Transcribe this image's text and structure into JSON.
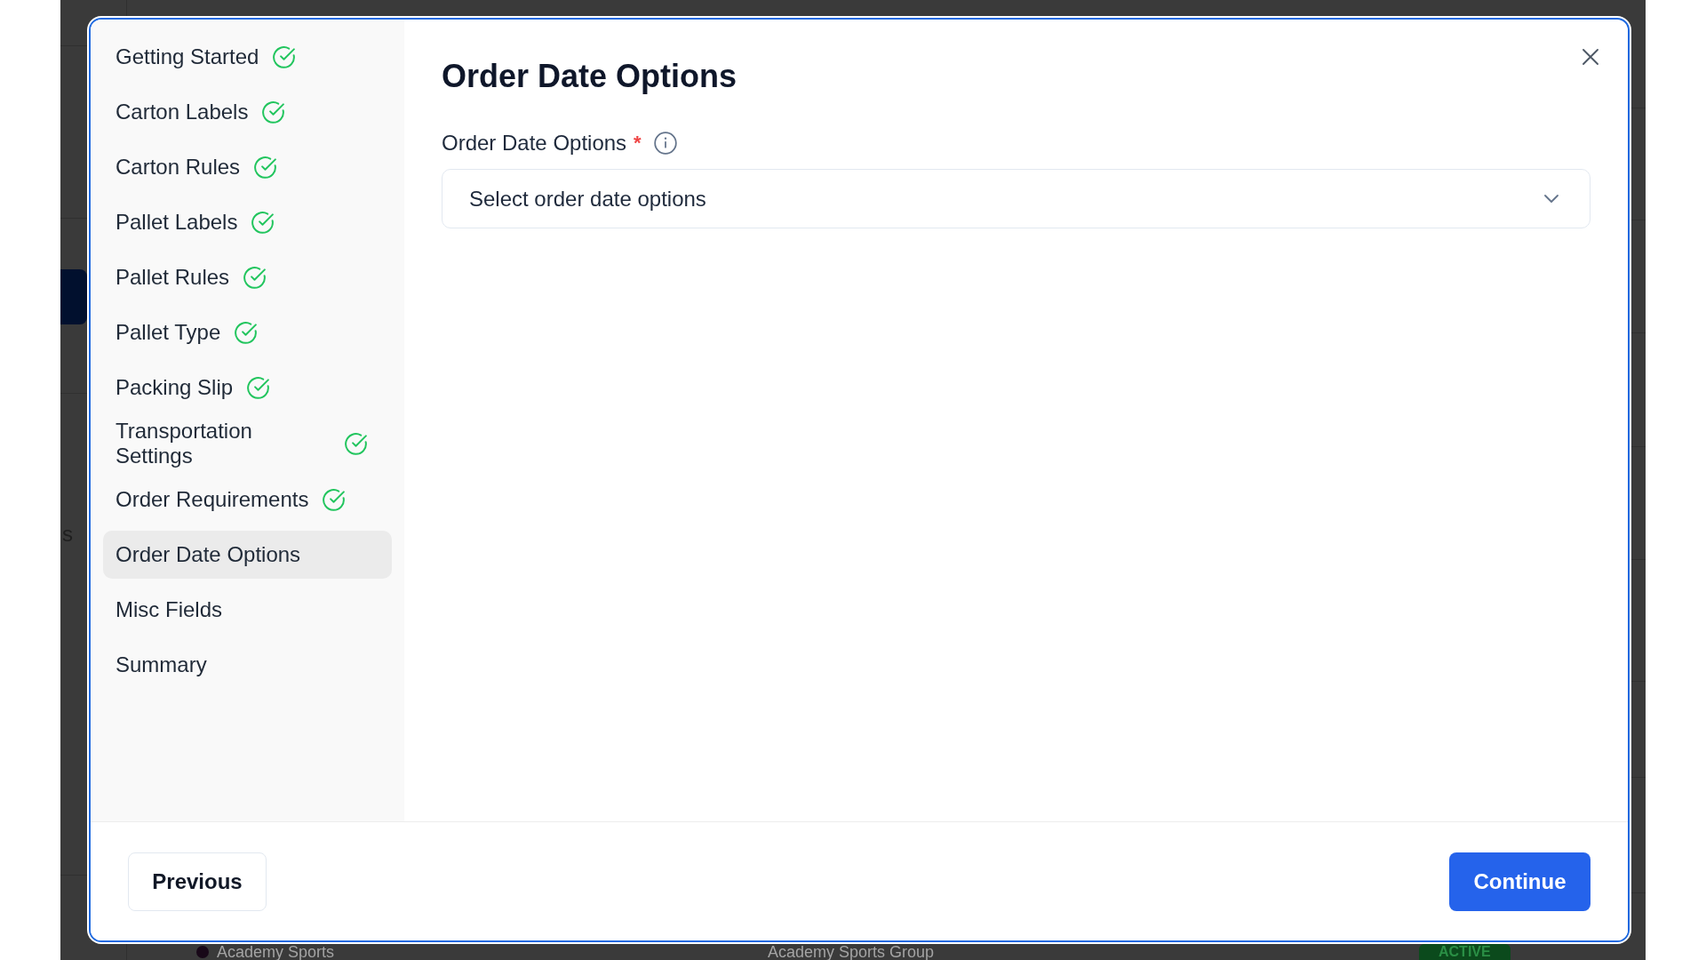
{
  "background": {
    "nav_text": "s",
    "row": {
      "name": "Academy Sports",
      "group": "Academy Sports Group",
      "status": "ACTIVE"
    }
  },
  "dialog": {
    "steps": [
      {
        "label": "Getting Started",
        "completed": true,
        "selected": false
      },
      {
        "label": "Carton Labels",
        "completed": true,
        "selected": false
      },
      {
        "label": "Carton Rules",
        "completed": true,
        "selected": false
      },
      {
        "label": "Pallet Labels",
        "completed": true,
        "selected": false
      },
      {
        "label": "Pallet Rules",
        "completed": true,
        "selected": false
      },
      {
        "label": "Pallet Type",
        "completed": true,
        "selected": false
      },
      {
        "label": "Packing Slip",
        "completed": true,
        "selected": false
      },
      {
        "label": "Transportation Settings",
        "completed": true,
        "selected": false
      },
      {
        "label": "Order Requirements",
        "completed": true,
        "selected": false
      },
      {
        "label": "Order Date Options",
        "completed": false,
        "selected": true
      },
      {
        "label": "Misc Fields",
        "completed": false,
        "selected": false
      },
      {
        "label": "Summary",
        "completed": false,
        "selected": false
      }
    ],
    "title": "Order Date Options",
    "field": {
      "label": "Order Date Options",
      "required_mark": "*",
      "placeholder": "Select order date options"
    },
    "buttons": [
      {
        "label": "Previous",
        "kind": "secondary"
      },
      {
        "label": "Continue",
        "kind": "primary"
      }
    ]
  }
}
